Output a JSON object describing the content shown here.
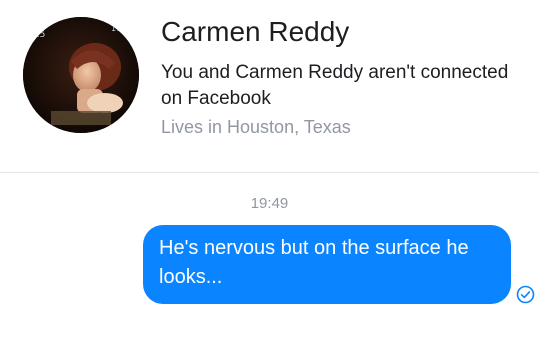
{
  "contact": {
    "name": "Carmen Reddy",
    "connection_status": "You and Carmen Reddy aren't connected on Facebook",
    "location": "Lives in Houston, Texas"
  },
  "conversation": {
    "timestamp": "19:49",
    "messages": [
      {
        "direction": "outgoing",
        "text": "He's nervous but on the surface he looks...",
        "status_icon": "sent-check-icon"
      }
    ]
  },
  "colors": {
    "outgoing_bubble": "#0a84ff",
    "secondary_text": "#9197a3",
    "primary_text": "#1c1e21"
  }
}
